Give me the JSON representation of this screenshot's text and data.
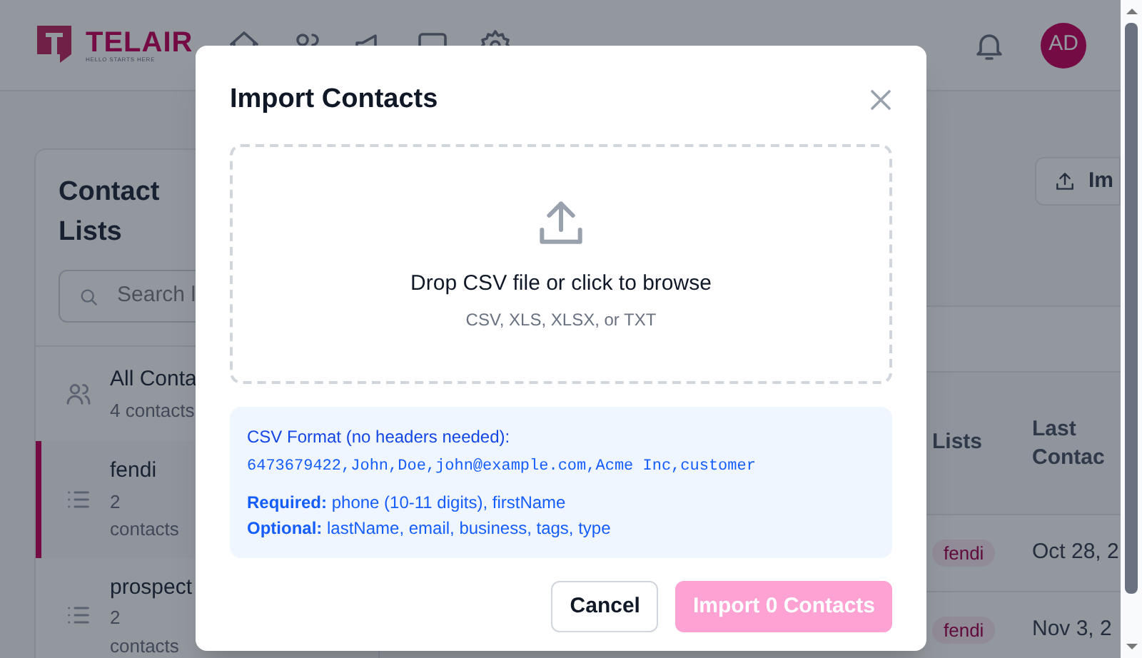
{
  "header": {
    "logo_text": "TELAIR",
    "tagline": "HELLO STARTS HERE",
    "avatar": "AD"
  },
  "sidebar": {
    "title": "Contact Lists",
    "search_placeholder": "Search l",
    "lists": [
      {
        "kind": "all",
        "name": "All Conta",
        "count": "4 contacts",
        "selected": false
      },
      {
        "kind": "list",
        "name": "fendi",
        "count": "2 contacts",
        "selected": true
      },
      {
        "kind": "list",
        "name": "prospect",
        "count": "2 contacts",
        "selected": false
      }
    ]
  },
  "import_button": "Im",
  "table": {
    "columns": [
      "Lists",
      "Last Contac"
    ],
    "rows": [
      {
        "list": "fendi",
        "last_contact": "Oct 28, 2"
      },
      {
        "list": "fendi",
        "last_contact": "Nov 3, 2"
      }
    ]
  },
  "modal": {
    "title": "Import Contacts",
    "dropzone": {
      "prompt": "Drop CSV file or click to browse",
      "formats": "CSV, XLS, XLSX, or TXT"
    },
    "format_box": {
      "heading": "CSV Format (no headers needed):",
      "example": "6473679422,John,Doe,john@example.com,Acme Inc,customer",
      "required": "**Required:** phone (10-11 digits), firstName",
      "optional": "**Optional:** lastName, email, business, tags, type"
    },
    "buttons": [
      {
        "kind": "secondary",
        "label": "Cancel",
        "disabled": false
      },
      {
        "kind": "primary",
        "label": "Import 0 Contacts",
        "disabled": true
      }
    ]
  }
}
